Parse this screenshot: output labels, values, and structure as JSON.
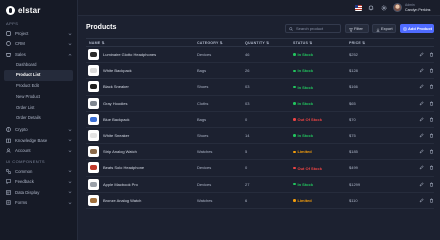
{
  "app": {
    "logo_text": "elstar"
  },
  "sidebar": {
    "apps_label": "APPS",
    "items": [
      {
        "label": "Project",
        "icon": "project-icon"
      },
      {
        "label": "CRM",
        "icon": "crm-icon"
      },
      {
        "label": "Sales",
        "icon": "sales-icon"
      }
    ],
    "sales_sub": [
      "Dashboard",
      "Product List",
      "Product Edit",
      "New Product",
      "Order List",
      "Order Details"
    ],
    "active_sub": "Product List",
    "items2": [
      {
        "label": "Crypto",
        "icon": "crypto-icon"
      },
      {
        "label": "Knowledge Base",
        "icon": "knowledge-icon"
      },
      {
        "label": "Account",
        "icon": "account-icon"
      }
    ],
    "ui_label": "UI COMPONENTS",
    "items3": [
      {
        "label": "Common",
        "icon": "common-icon"
      },
      {
        "label": "Feedback",
        "icon": "feedback-icon"
      },
      {
        "label": "Data Display",
        "icon": "data-display-icon"
      },
      {
        "label": "Forms",
        "icon": "forms-icon"
      }
    ]
  },
  "header": {
    "user_role": "Admin",
    "user_name": "Carolyn Perkins"
  },
  "page": {
    "title": "Products",
    "search_placeholder": "Search product",
    "filter_label": "Filter",
    "export_label": "Export",
    "add_label": "Add Product"
  },
  "table": {
    "headers": [
      "NAME ⇅",
      "CATEGORY ⇅",
      "QUANTITY ⇅",
      "STATUS ⇅",
      "PRICE ⇅"
    ],
    "rows": [
      {
        "name": "Luminaire Giotto Headphones",
        "category": "Devices",
        "qty": "46",
        "status": "In Stock",
        "price": "$252",
        "thumb": "#2b2b2b"
      },
      {
        "name": "White Backpack",
        "category": "Bags",
        "qty": "26",
        "status": "In Stock",
        "price": "$128",
        "thumb": "#dcdcdc"
      },
      {
        "name": "Black Sneaker",
        "category": "Shoes",
        "qty": "03",
        "status": "In Stock",
        "price": "$166",
        "thumb": "#1f1f1f"
      },
      {
        "name": "Gray Hoodies",
        "category": "Cloths",
        "qty": "03",
        "status": "In Stock",
        "price": "$65",
        "thumb": "#7f8690"
      },
      {
        "name": "Blue Backpack",
        "category": "Bags",
        "qty": "0",
        "status": "Out Of Stock",
        "price": "$70",
        "thumb": "#3b6fd6"
      },
      {
        "name": "White Sneaker",
        "category": "Shoes",
        "qty": "14",
        "status": "In Stock",
        "price": "$75",
        "thumb": "#e4e4e4"
      },
      {
        "name": "Strip Analog Watch",
        "category": "Watches",
        "qty": "5",
        "status": "Limited",
        "price": "$185",
        "thumb": "#8a6a4a"
      },
      {
        "name": "Beats Solo Headphone",
        "category": "Devices",
        "qty": "0",
        "status": "Out Of Stock",
        "price": "$499",
        "thumb": "#c0392b"
      },
      {
        "name": "Apple Macbook Pro",
        "category": "Devices",
        "qty": "27",
        "status": "In Stock",
        "price": "$1299",
        "thumb": "#9aa0a8"
      },
      {
        "name": "Bronze Analog Watch",
        "category": "Watches",
        "qty": "6",
        "status": "Limited",
        "price": "$110",
        "thumb": "#a0703c"
      }
    ]
  },
  "colors": {
    "in_stock": "#22c55e",
    "out_of_stock": "#ef4444",
    "limited": "#f59e0b",
    "accent": "#4f6bff"
  }
}
